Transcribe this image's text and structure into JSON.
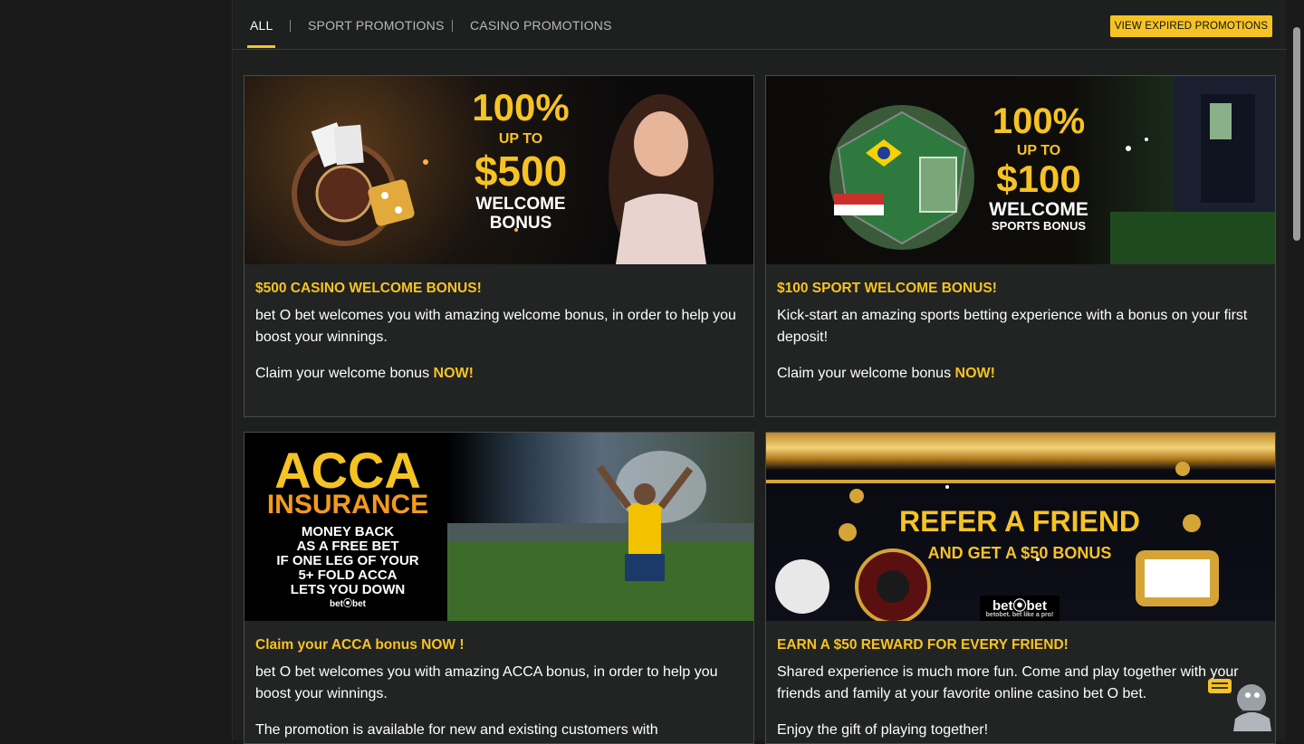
{
  "tabs": [
    {
      "label": "ALL"
    },
    {
      "label": "SPORT PROMOTIONS"
    },
    {
      "label": "CASINO PROMOTIONS"
    }
  ],
  "expired_button": "VIEW EXPIRED PROMOTIONS",
  "colors": {
    "accent": "#f6c324",
    "background": "#1e1f1f",
    "card_border": "#4a4a4a"
  },
  "cards": [
    {
      "banner": {
        "line1": "100%",
        "line2": "UP TO",
        "line3": "$500",
        "line4": "WELCOME",
        "line5": "BONUS"
      },
      "title": "$500 CASINO WELCOME BONUS!",
      "text": "bet O bet welcomes you with amazing welcome bonus, in order to help you boost your winnings.",
      "claim_prefix": "Claim your welcome bonus ",
      "claim_now": "NOW!"
    },
    {
      "banner": {
        "line1": "100%",
        "line2": "UP TO",
        "line3": "$100",
        "line4": "WELCOME",
        "line5": "SPORTS BONUS"
      },
      "title": "$100 SPORT WELCOME BONUS!",
      "text": "Kick-start an amazing sports betting experience with a bonus on your first deposit!",
      "claim_prefix": "Claim your welcome bonus ",
      "claim_now": "NOW!"
    },
    {
      "banner": {
        "line1": "ACCA",
        "line2": "INSURANCE",
        "line3": "MONEY BACK",
        "line4": "AS A FREE BET",
        "line5": "IF ONE LEG OF YOUR",
        "line6": "5+ FOLD ACCA",
        "line7": "LETS YOU DOWN",
        "logo": "bet⦿bet"
      },
      "title": "Claim your ACCA bonus NOW !",
      "text": "bet O bet welcomes you with amazing ACCA bonus, in order to help you boost your winnings.",
      "extra": "The promotion is available for new and existing customers with"
    },
    {
      "banner": {
        "line1": "REFER A FRIEND",
        "line2": "AND GET A $50 BONUS",
        "logo": "bet⦿bet",
        "tagline": "betobet. bet like a pro!"
      },
      "title": "EARN A $50 REWARD FOR EVERY FRIEND!",
      "text": "Shared experience is much more fun. Come and play together with your friends and family at your favorite online casino bet O bet.",
      "extra": "Enjoy the gift of playing together!"
    }
  ]
}
